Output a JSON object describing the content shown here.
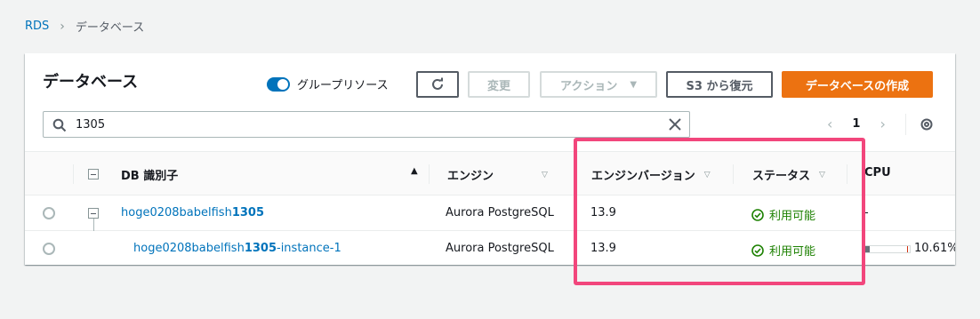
{
  "breadcrumb": {
    "root": "RDS",
    "current": "データベース"
  },
  "panel": {
    "title": "データベース",
    "group_toggle_label": "グループリソース",
    "buttons": {
      "modify": "変更",
      "actions": "アクション",
      "restore_s3": "S3 から復元",
      "create": "データベースの作成"
    },
    "search_value": "1305",
    "page_number": "1"
  },
  "table": {
    "columns": {
      "db_id": "DB 識別子",
      "engine": "エンジン",
      "engine_version": "エンジンバージョン",
      "status": "ステータス",
      "cpu": "CPU"
    },
    "rows": [
      {
        "id_prefix": "hoge0208babelfish",
        "id_match": "1305",
        "id_suffix": "",
        "engine": "Aurora PostgreSQL",
        "engine_version": "13.9",
        "status": "利用可能",
        "cpu": "-"
      },
      {
        "id_prefix": "hoge0208babelfish",
        "id_match": "1305",
        "id_suffix": "-instance-1",
        "engine": "Aurora PostgreSQL",
        "engine_version": "13.9",
        "status": "利用可能",
        "cpu": "10.61%",
        "cpu_fraction": 0.1061
      }
    ]
  },
  "colors": {
    "link": "#0073bb",
    "primary": "#ec7211",
    "success": "#1d8102",
    "highlight": "#f2467c"
  }
}
